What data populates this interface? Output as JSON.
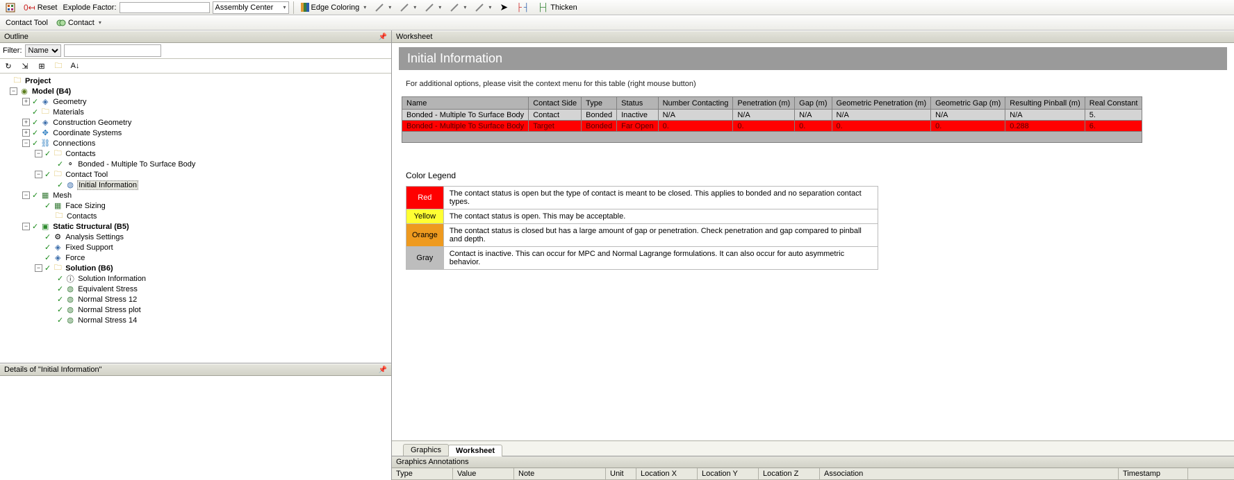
{
  "toolbar1": {
    "reset_label": "Reset",
    "explode_label": "Explode Factor:",
    "assembly_label": "Assembly Center",
    "edgecolor_label": "Edge Coloring",
    "thicken_label": "Thicken"
  },
  "toolbar2": {
    "contacttool_label": "Contact Tool",
    "contact_label": "Contact"
  },
  "outline": {
    "title": "Outline",
    "filter_label": "Filter:",
    "filter_type": "Name",
    "tree": {
      "project": "Project",
      "model": "Model (B4)",
      "geometry": "Geometry",
      "materials": "Materials",
      "construction_geom": "Construction Geometry",
      "coord_sys": "Coordinate Systems",
      "connections": "Connections",
      "contacts": "Contacts",
      "bonded": "Bonded - Multiple To Surface Body",
      "contact_tool": "Contact Tool",
      "initial_info": "Initial Information",
      "mesh": "Mesh",
      "face_sizing": "Face Sizing",
      "contacts2": "Contacts",
      "static": "Static Structural (B5)",
      "analysis": "Analysis Settings",
      "fixed": "Fixed Support",
      "force": "Force",
      "solution": "Solution (B6)",
      "solution_info": "Solution Information",
      "eq_stress": "Equivalent Stress",
      "ns12": "Normal Stress 12",
      "nsplot": "Normal Stress plot",
      "ns14": "Normal Stress 14"
    }
  },
  "details": {
    "title": "Details of \"Initial Information\""
  },
  "worksheet": {
    "panel_label": "Worksheet",
    "heading": "Initial Information",
    "note": "For additional options, please visit the context menu for this table (right mouse button)",
    "headers": [
      "Name",
      "Contact Side",
      "Type",
      "Status",
      "Number Contacting",
      "Penetration (m)",
      "Gap (m)",
      "Geometric Penetration (m)",
      "Geometric Gap (m)",
      "Resulting Pinball (m)",
      "Real Constant"
    ],
    "rows": [
      {
        "cls": "row-gray",
        "cells": [
          "Bonded - Multiple To Surface Body",
          "Contact",
          "Bonded",
          "Inactive",
          "N/A",
          "N/A",
          "N/A",
          "N/A",
          "N/A",
          "N/A",
          "5."
        ]
      },
      {
        "cls": "row-red",
        "cells": [
          "Bonded - Multiple To Surface Body",
          "Target",
          "Bonded",
          "Far Open",
          "0.",
          "0.",
          "0.",
          "0.",
          "0.",
          "0.288",
          "6."
        ]
      }
    ],
    "legend_title": "Color Legend",
    "legend": [
      {
        "swatch": "swatch-red",
        "name": "Red",
        "desc": "The contact status is open but the type of contact is meant to be closed. This applies to bonded and no separation contact types."
      },
      {
        "swatch": "swatch-yellow",
        "name": "Yellow",
        "desc": "The contact status is open. This may be acceptable."
      },
      {
        "swatch": "swatch-orange",
        "name": "Orange",
        "desc": "The contact status is closed but has a large amount of gap or penetration. Check penetration and gap compared to pinball and depth."
      },
      {
        "swatch": "swatch-gray",
        "name": "Gray",
        "desc": "Contact is inactive. This can occur for MPC and Normal Lagrange formulations. It can also occur for auto asymmetric behavior."
      }
    ]
  },
  "tabs": {
    "graphics": "Graphics",
    "worksheet": "Worksheet"
  },
  "annotations": {
    "title": "Graphics Annotations",
    "cols": [
      "Type",
      "Value",
      "Note",
      "Unit",
      "Location X",
      "Location Y",
      "Location Z",
      "Association",
      "Timestamp"
    ]
  }
}
